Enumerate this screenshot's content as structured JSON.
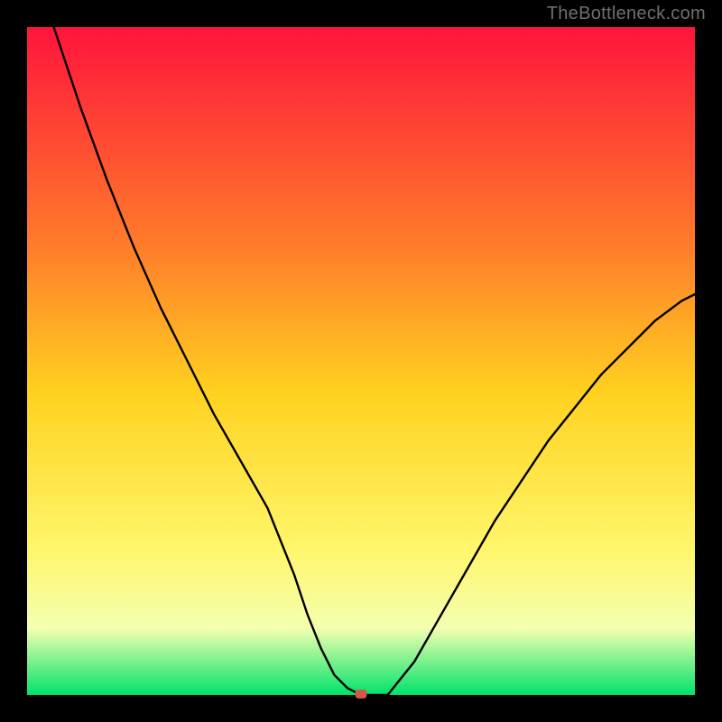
{
  "watermark": "TheBottleneck.com",
  "chart_data": {
    "type": "line",
    "title": "",
    "xlabel": "",
    "ylabel": "",
    "xlim": [
      0,
      100
    ],
    "ylim": [
      0,
      100
    ],
    "x": [
      4,
      8,
      12,
      16,
      20,
      24,
      28,
      32,
      36,
      40,
      42,
      44,
      46,
      48,
      50,
      54,
      58,
      62,
      66,
      70,
      74,
      78,
      82,
      86,
      90,
      94,
      98,
      100
    ],
    "values": [
      100,
      88,
      77,
      67,
      58,
      50,
      42,
      35,
      28,
      18,
      12,
      7,
      3,
      1,
      0,
      0,
      5,
      12,
      19,
      26,
      32,
      38,
      43,
      48,
      52,
      56,
      59,
      60
    ],
    "marker": {
      "x": 50,
      "y": 0,
      "color": "#d6574a"
    },
    "colors": {
      "gradient_top": "#ff143c",
      "gradient_mid1": "#ff7d2a",
      "gradient_mid2": "#ffd220",
      "gradient_mid3": "#fff66a",
      "gradient_mid4": "#f4ffb0",
      "gradient_bottom": "#00e36a",
      "curve": "#000000",
      "frame": "#000000"
    }
  }
}
